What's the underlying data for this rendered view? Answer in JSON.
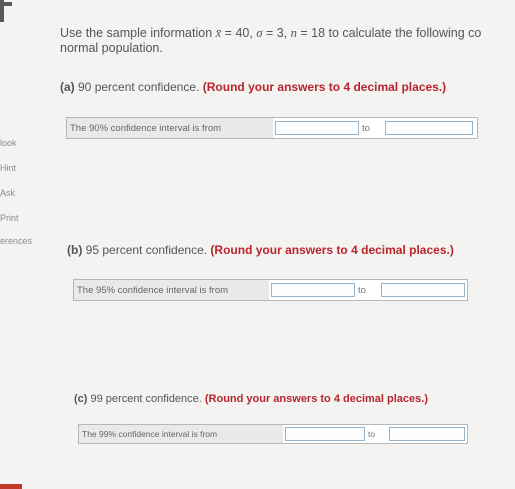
{
  "problem": {
    "line1_prefix": "Use the sample information ",
    "xbar": "x̄",
    "eq1": " = 40, ",
    "sigma": "σ",
    "eq2": " = 3, ",
    "n": "n",
    "eq3": " = 18 to calculate the following co",
    "line2": "normal population."
  },
  "sidebar": {
    "items": [
      "look",
      "Hint",
      "Ask",
      "Print",
      "erences"
    ]
  },
  "parts": [
    {
      "letter": "(a)",
      "text": " 90 percent confidence. ",
      "round": "(Round your answers to 4 decimal places.)",
      "row_label": "The 90% confidence interval is from",
      "to_label": "to",
      "lower_value": "",
      "upper_value": ""
    },
    {
      "letter": "(b)",
      "text": " 95 percent confidence. ",
      "round": "(Round your answers to 4 decimal places.)",
      "row_label": "The 95% confidence interval is from",
      "to_label": "to",
      "lower_value": "",
      "upper_value": ""
    },
    {
      "letter": "(c)",
      "text": " 99 percent confidence. ",
      "round": "(Round your answers to 4 decimal places.)",
      "row_label": "The 99% confidence interval is from",
      "to_label": "to",
      "lower_value": "",
      "upper_value": ""
    }
  ],
  "colors": {
    "round_text": "#b8252d",
    "input_border": "#9bb3c8"
  }
}
